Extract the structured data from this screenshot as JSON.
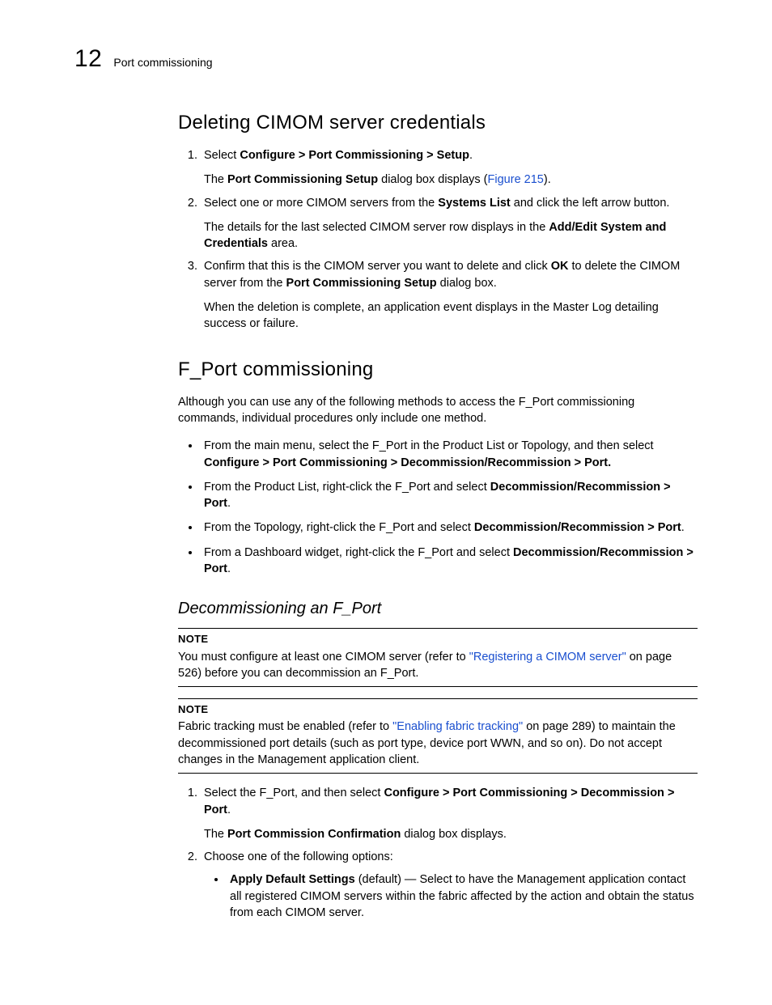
{
  "header": {
    "chapter_number": "12",
    "breadcrumb": "Port commissioning"
  },
  "section1": {
    "title": "Deleting CIMOM server credentials",
    "steps": [
      {
        "lead": "Select ",
        "bold1": "Configure > Port Commissioning > Setup",
        "tail1": ".",
        "para2_pre": "The ",
        "para2_bold": "Port Commissioning Setup",
        "para2_mid": " dialog box displays (",
        "para2_link": "Figure 215",
        "para2_post": ")."
      },
      {
        "lead": "Select one or more CIMOM servers from the ",
        "bold1": "Systems List",
        "tail1": " and click the left arrow button.",
        "para2_pre": "The details for the last selected CIMOM server row displays in the ",
        "para2_bold": "Add/Edit System and Credentials",
        "para2_post": " area."
      },
      {
        "lead": "Confirm that this is the CIMOM server you want to delete and click ",
        "bold1": "OK",
        "mid1": " to delete the CIMOM server from the ",
        "bold2": "Port Commissioning Setup",
        "tail1": " dialog box.",
        "para2": "When the deletion is complete, an application event displays in the Master Log detailing success or failure."
      }
    ]
  },
  "section2": {
    "title": "F_Port commissioning",
    "intro": "Although you can use any of the following methods to access the F_Port commissioning commands, individual procedures only include one method.",
    "bullets": [
      {
        "pre": "From the main menu, select the F_Port in the Product List or Topology, and then select ",
        "bold": "Configure > Port Commissioning > Decommission/Recommission > Port.",
        "post": ""
      },
      {
        "pre": "From the Product List, right-click the F_Port and select ",
        "bold": "Decommission/Recommission > Port",
        "post": "."
      },
      {
        "pre": "From the Topology, right-click the F_Port and select ",
        "bold": "Decommission/Recommission > Port",
        "post": "."
      },
      {
        "pre": "From a Dashboard widget, right-click the F_Port and select ",
        "bold": "Decommission/Recommission > Port",
        "post": "."
      }
    ]
  },
  "section3": {
    "title": "Decommissioning an F_Port",
    "note1": {
      "label": "NOTE",
      "pre": "You must configure at least one CIMOM server (refer to ",
      "link": "\"Registering a CIMOM server\"",
      "post": " on page 526) before you can decommission an F_Port."
    },
    "note2": {
      "label": "NOTE",
      "pre": "Fabric tracking must be enabled (refer to ",
      "link": "\"Enabling fabric tracking\"",
      "post": " on page 289) to maintain the decommissioned port details (such as port type, device port WWN, and so on). Do not accept changes in the Management application client."
    },
    "steps": [
      {
        "lead": "Select the F_Port, and then select ",
        "bold1": "Configure > Port Commissioning > Decommission > Port",
        "tail1": ".",
        "para2_pre": "The ",
        "para2_bold": "Port Commission Confirmation",
        "para2_post": " dialog box displays."
      },
      {
        "lead": "Choose one of the following options:",
        "sub": {
          "bold": "Apply Default Settings",
          "rest": " (default) — Select to have the Management application contact all registered CIMOM servers within the fabric affected by the action and obtain the status from each CIMOM server."
        }
      }
    ]
  }
}
